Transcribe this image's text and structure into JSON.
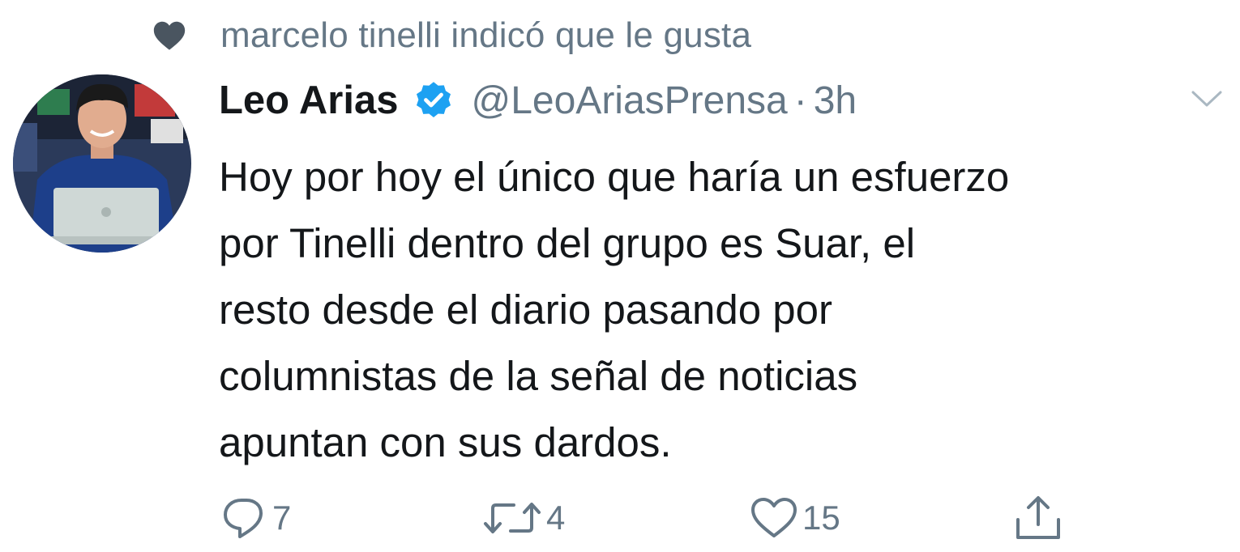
{
  "social_context": {
    "icon": "heart-icon",
    "text": "marcelo tinelli indicó que le gusta"
  },
  "tweet": {
    "author": {
      "name": "Leo Arias",
      "verified": true,
      "handle": "@LeoAriasPrensa",
      "separator": "·",
      "time": "3h",
      "avatar": "avatar-photo"
    },
    "text_lines": [
      "Hoy por hoy el único que haría un esfuerzo",
      "por Tinelli dentro del grupo es Suar, el",
      "resto desde el diario pasando por",
      "columnistas de la señal de noticias",
      "apuntan con sus dardos."
    ],
    "actions": {
      "reply": {
        "icon": "reply-icon",
        "count": "7"
      },
      "retweet": {
        "icon": "retweet-icon",
        "count": "4"
      },
      "like": {
        "icon": "heart-outline-icon",
        "count": "15"
      },
      "share": {
        "icon": "share-icon"
      }
    }
  },
  "colors": {
    "text": "#14171a",
    "muted": "#657786",
    "verified": "#1da1f2",
    "background": "#ffffff"
  }
}
